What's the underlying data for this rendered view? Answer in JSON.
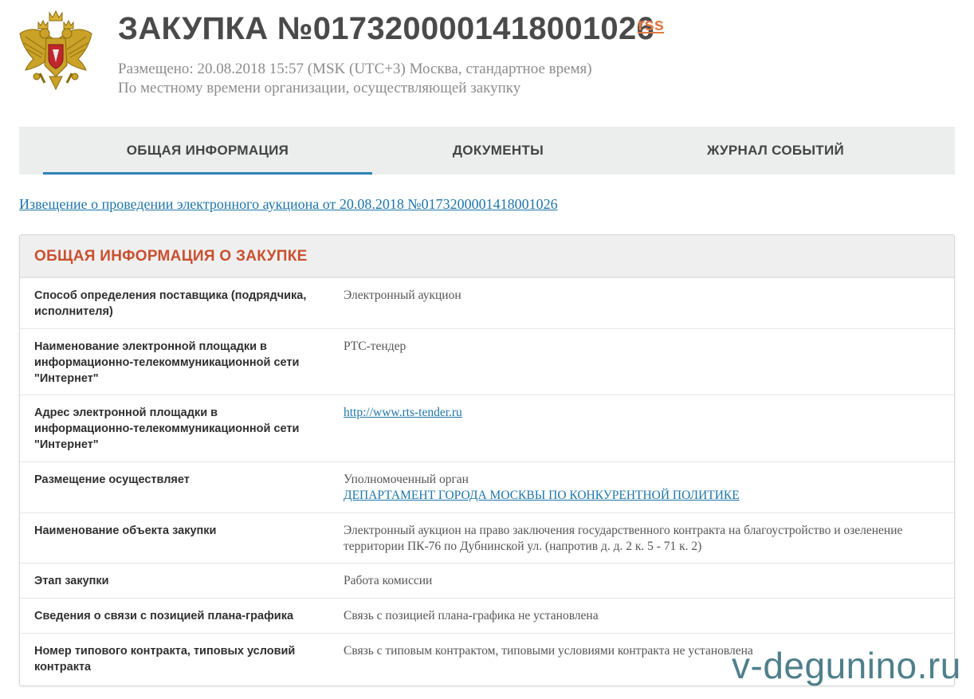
{
  "header": {
    "title": "ЗАКУПКА №0173200001418001026",
    "rss": "rss",
    "posted": "Размещено: 20.08.2018 15:57 (MSK (UTC+3) Москва, стандартное время)",
    "local_time_note": "По местному времени организации, осуществляющей закупку",
    "emblem_icon": "russian-coat-of-arms-icon"
  },
  "tabs": [
    {
      "label": "ОБЩАЯ ИНФОРМАЦИЯ",
      "active": true
    },
    {
      "label": "ДОКУМЕНТЫ",
      "active": false
    },
    {
      "label": "ЖУРНАЛ СОБЫТИЙ",
      "active": false
    }
  ],
  "notice_link": "Извещение о проведении электронного аукциона от 20.08.2018 №0173200001418001026",
  "panel": {
    "title": "ОБЩАЯ ИНФОРМАЦИЯ О ЗАКУПКЕ",
    "rows": [
      {
        "label": "Способ определения поставщика (подрядчика, исполнителя)",
        "value": "Электронный аукцион"
      },
      {
        "label": "Наименование электронной площадки в информационно-телекоммуникационной сети \"Интернет\"",
        "value": "РТС-тендер"
      },
      {
        "label": "Адрес электронной площадки в информационно-телекоммуникационной сети \"Интернет\"",
        "value": "http://www.rts-tender.ru"
      },
      {
        "label": "Размещение осуществляет",
        "value": "Уполномоченный орган",
        "value_link": "ДЕПАРТАМЕНТ ГОРОДА МОСКВЫ ПО КОНКУРЕНТНОЙ ПОЛИТИКЕ"
      },
      {
        "label": "Наименование объекта закупки",
        "value": "Электронный аукцион на право заключения государственного контракта на благоустройство и озеленение территории ПК-76 по Дубнинской ул. (напротив д. д. 2 к. 5 - 71 к. 2)"
      },
      {
        "label": "Этап закупки",
        "value": "Работа комиссии"
      },
      {
        "label": "Сведения о связи с позицией плана-графика",
        "value": "Связь с позицией плана-графика не установлена"
      },
      {
        "label": "Номер типового контракта, типовых условий контракта",
        "value": "Связь с типовым контрактом, типовыми условиями контракта не установлена"
      }
    ]
  },
  "watermark": "v-degunino.ru",
  "colors": {
    "accent_blue": "#2b84b6",
    "title_red": "#c9502f",
    "rss_orange": "#e07a42"
  }
}
